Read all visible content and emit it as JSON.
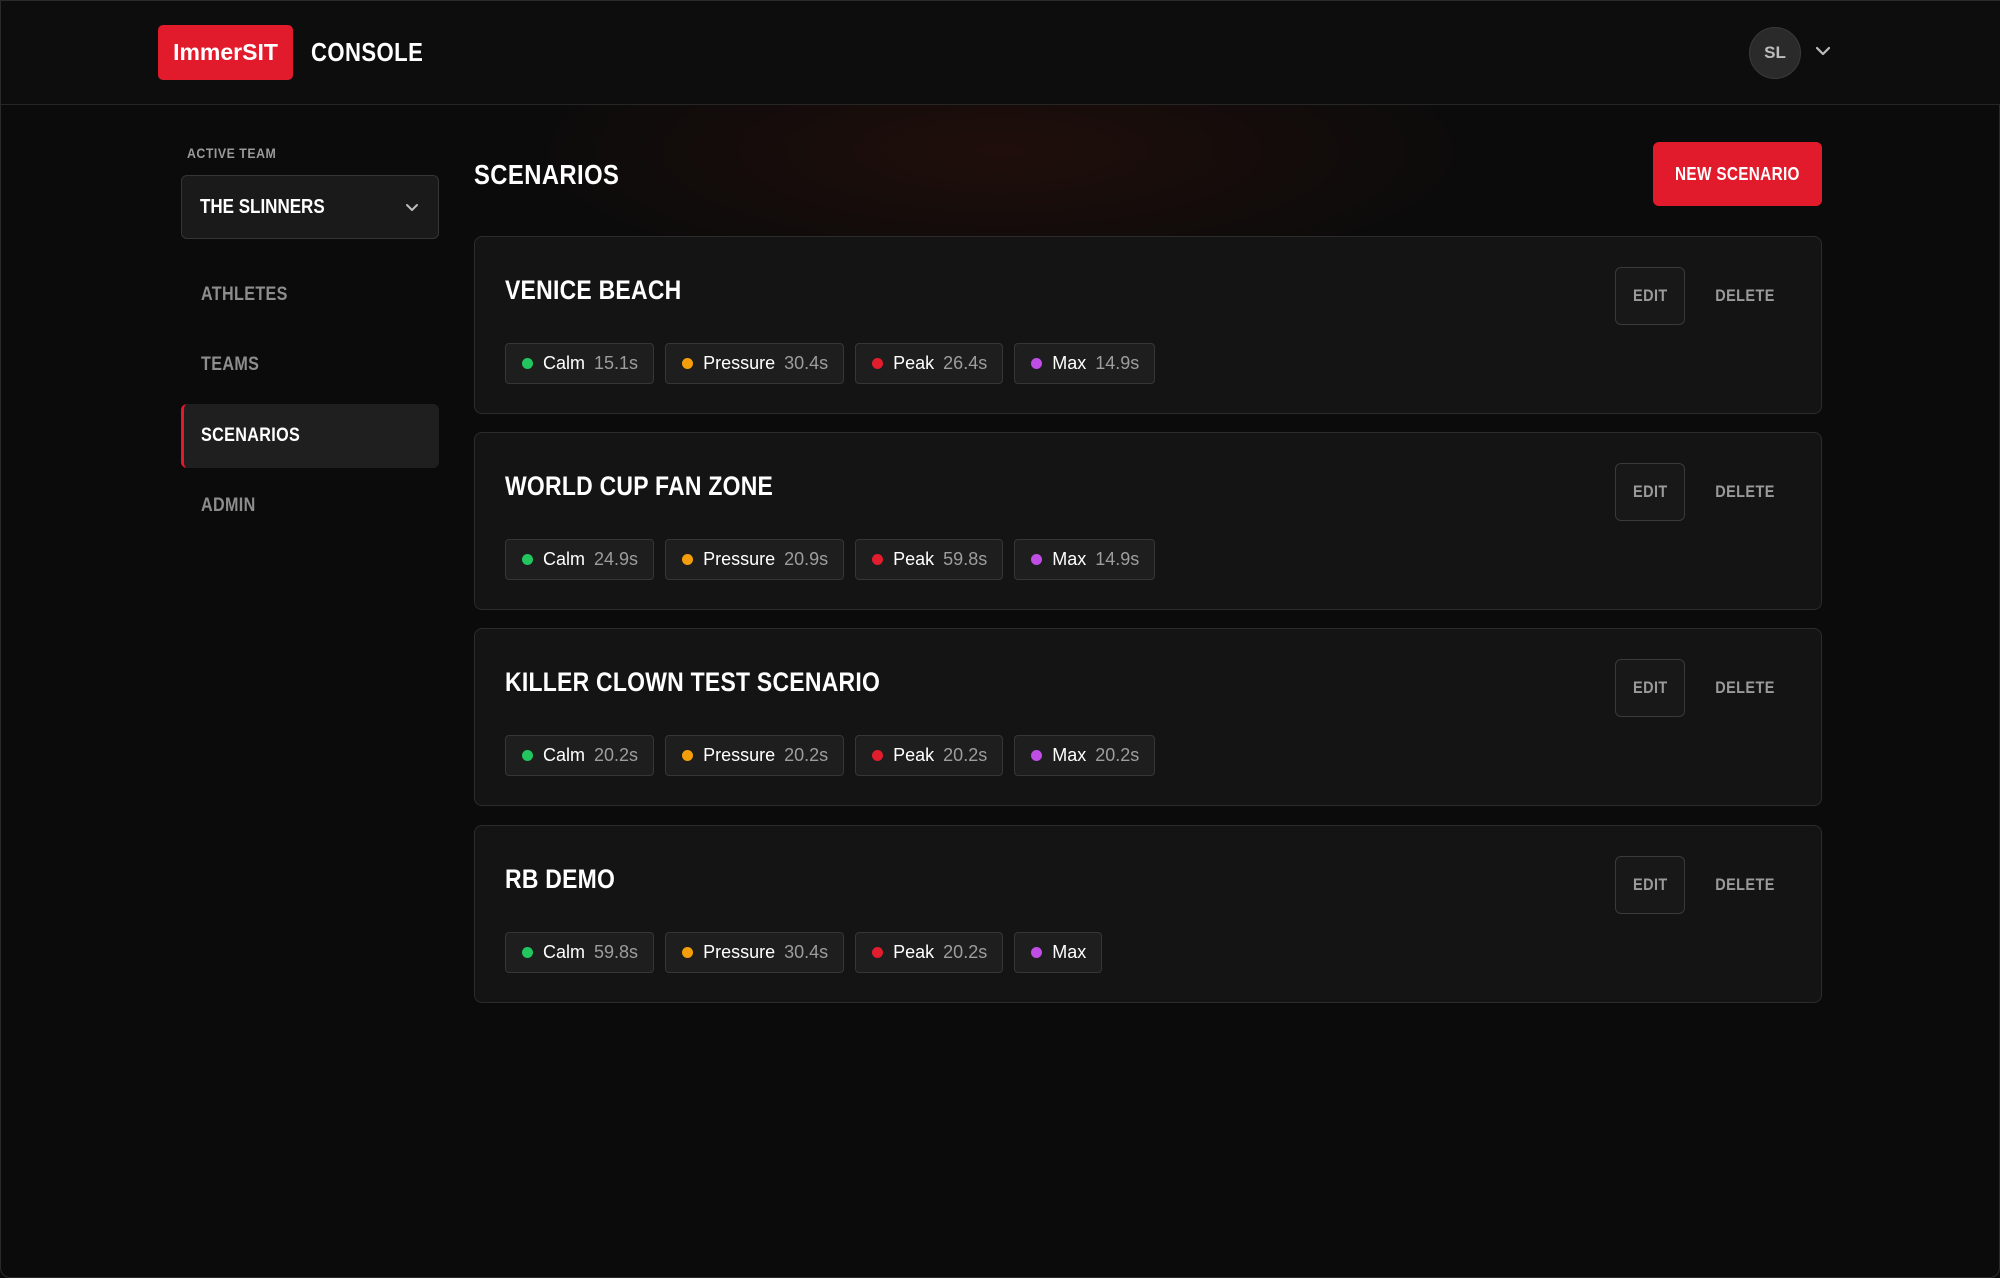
{
  "header": {
    "logo_text": "ImmerSIT",
    "app_label": "CONSOLE",
    "user_initials": "SL"
  },
  "sidebar": {
    "active_team_label": "ACTIVE TEAM",
    "team_select_value": "THE SLINNERS",
    "items": [
      {
        "label": "ATHLETES",
        "active": false
      },
      {
        "label": "TEAMS",
        "active": false
      },
      {
        "label": "SCENARIOS",
        "active": true
      },
      {
        "label": "ADMIN",
        "active": false
      }
    ]
  },
  "main": {
    "title": "SCENARIOS",
    "new_button_label": "NEW SCENARIO",
    "edit_label": "EDIT",
    "delete_label": "DELETE",
    "scenarios": [
      {
        "name": "VENICE BEACH",
        "phases": [
          {
            "label": "Calm",
            "value": "15.1s",
            "color": "green"
          },
          {
            "label": "Pressure",
            "value": "30.4s",
            "color": "orange"
          },
          {
            "label": "Peak",
            "value": "26.4s",
            "color": "red"
          },
          {
            "label": "Max",
            "value": "14.9s",
            "color": "purple"
          }
        ]
      },
      {
        "name": "WORLD CUP FAN ZONE",
        "phases": [
          {
            "label": "Calm",
            "value": "24.9s",
            "color": "green"
          },
          {
            "label": "Pressure",
            "value": "20.9s",
            "color": "orange"
          },
          {
            "label": "Peak",
            "value": "59.8s",
            "color": "red"
          },
          {
            "label": "Max",
            "value": "14.9s",
            "color": "purple"
          }
        ]
      },
      {
        "name": "KILLER CLOWN TEST SCENARIO",
        "phases": [
          {
            "label": "Calm",
            "value": "20.2s",
            "color": "green"
          },
          {
            "label": "Pressure",
            "value": "20.2s",
            "color": "orange"
          },
          {
            "label": "Peak",
            "value": "20.2s",
            "color": "red"
          },
          {
            "label": "Max",
            "value": "20.2s",
            "color": "purple"
          }
        ]
      },
      {
        "name": "RB DEMO",
        "phases": [
          {
            "label": "Calm",
            "value": "59.8s",
            "color": "green"
          },
          {
            "label": "Pressure",
            "value": "30.4s",
            "color": "orange"
          },
          {
            "label": "Peak",
            "value": "20.2s",
            "color": "red"
          },
          {
            "label": "Max",
            "value": "",
            "color": "purple"
          }
        ]
      }
    ]
  },
  "colors": {
    "accent": "#e21b2c",
    "green": "#22c55e",
    "orange": "#f59e0b",
    "red": "#e11d2e",
    "purple": "#c04ee6"
  }
}
